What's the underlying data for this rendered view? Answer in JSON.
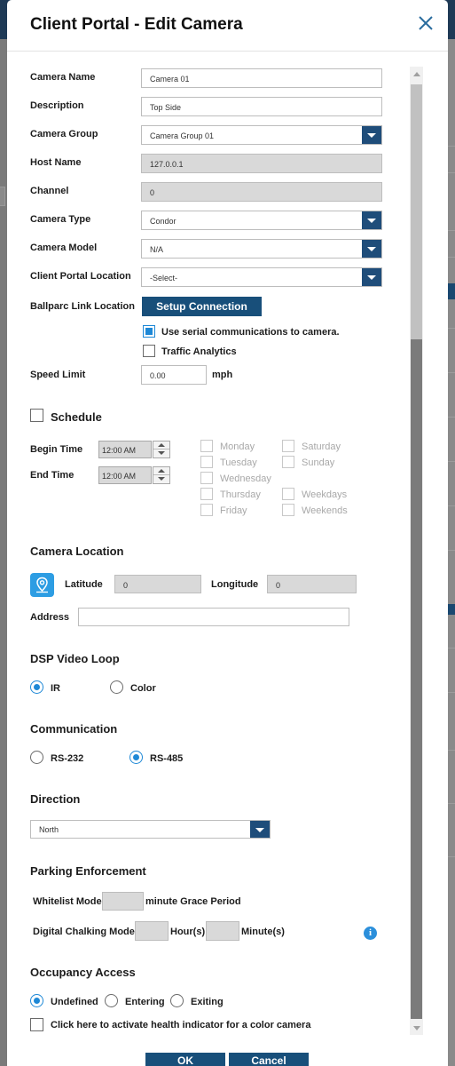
{
  "modal": {
    "title": "Client Portal - Edit Camera"
  },
  "fields": {
    "camera_name": {
      "label": "Camera Name",
      "value": "Camera 01"
    },
    "description": {
      "label": "Description",
      "value": "Top Side"
    },
    "camera_group": {
      "label": "Camera Group",
      "value": "Camera Group 01"
    },
    "host_name": {
      "label": "Host Name",
      "value": "127.0.0.1"
    },
    "channel": {
      "label": "Channel",
      "value": "0"
    },
    "camera_type": {
      "label": "Camera Type",
      "value": "Condor"
    },
    "camera_model": {
      "label": "Camera Model",
      "value": "N/A"
    },
    "portal_location": {
      "label": "Client Portal Location",
      "value": "-Select-"
    },
    "ballparc": {
      "label": "Ballparc Link Location",
      "button": "Setup Connection"
    },
    "serial_comm": {
      "label": "Use serial communications to camera.",
      "checked": true
    },
    "traffic_analytics": {
      "label": "Traffic Analytics",
      "checked": false
    },
    "speed_limit": {
      "label": "Speed Limit",
      "value": "0.00",
      "unit": "mph"
    }
  },
  "schedule": {
    "label": "Schedule",
    "begin_label": "Begin Time",
    "begin_value": "12:00 AM",
    "end_label": "End Time",
    "end_value": "12:00 AM",
    "days": [
      "Monday",
      "Tuesday",
      "Wednesday",
      "Thursday",
      "Friday",
      "Saturday",
      "Sunday",
      "Weekdays",
      "Weekends"
    ]
  },
  "location": {
    "heading": "Camera Location",
    "latitude_label": "Latitude",
    "latitude_value": "0",
    "longitude_label": "Longitude",
    "longitude_value": "0",
    "address_label": "Address",
    "address_value": ""
  },
  "dsp": {
    "heading": "DSP Video Loop",
    "options": [
      "IR",
      "Color"
    ],
    "selected": "IR"
  },
  "communication": {
    "heading": "Communication",
    "options": [
      "RS-232",
      "RS-485"
    ],
    "selected": "RS-485"
  },
  "direction": {
    "heading": "Direction",
    "value": "North"
  },
  "parking": {
    "heading": "Parking Enforcement",
    "whitelist_label": "Whitelist Mode",
    "grace_label": "minute Grace Period",
    "chalking_label": "Digital Chalking Mode",
    "hours_label": "Hour(s)",
    "minutes_label": "Minute(s)",
    "info": "i"
  },
  "occupancy": {
    "heading": "Occupancy Access",
    "options": [
      "Undefined",
      "Entering",
      "Exiting"
    ],
    "selected": "Undefined",
    "health_label": "Click here to activate health indicator for a color camera"
  },
  "footer": {
    "ok": "OK",
    "cancel": "Cancel"
  },
  "colors": {
    "primary": "#184f7a",
    "accent": "#1e88d6",
    "topbar": "#1f3a56"
  }
}
